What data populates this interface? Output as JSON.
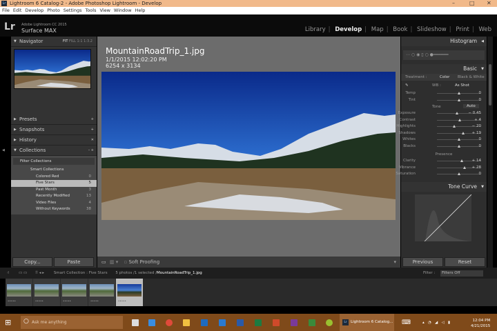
{
  "window": {
    "title": "Lightroom 6 Catalog-2 - Adobe Photoshop Lightroom - Develop"
  },
  "menu": [
    "File",
    "Edit",
    "Develop",
    "Photo",
    "Settings",
    "Tools",
    "View",
    "Window",
    "Help"
  ],
  "identity": {
    "logo": "Lr",
    "product": "Adobe Lightroom CC 2015",
    "name": "Surface MAX"
  },
  "modules": [
    {
      "label": "Library"
    },
    {
      "label": "Develop",
      "active": true
    },
    {
      "label": "Map"
    },
    {
      "label": "Book"
    },
    {
      "label": "Slideshow"
    },
    {
      "label": "Print"
    },
    {
      "label": "Web"
    }
  ],
  "left": {
    "navigator": {
      "title": "Navigator",
      "zoom": [
        "FIT",
        "FILL",
        "1:1",
        "1:3.2"
      ]
    },
    "panels": [
      "Presets",
      "Snapshots",
      "History",
      "Collections"
    ],
    "filter": "Filter Collections",
    "smart": "Smart Collections",
    "collections": [
      {
        "name": "Colored Red",
        "count": "0"
      },
      {
        "name": "Five Stars",
        "count": "5",
        "selected": true
      },
      {
        "name": "Past Month",
        "count": "3"
      },
      {
        "name": "Recently Modified",
        "count": "13"
      },
      {
        "name": "Video Files",
        "count": "4"
      },
      {
        "name": "Without Keywords",
        "count": "38"
      }
    ],
    "copy": "Copy...",
    "paste": "Paste"
  },
  "photo": {
    "filename": "MountainRoadTrip_1.jpg",
    "date": "1/1/2015 12:02:20 PM",
    "size": "6254 x 3134"
  },
  "toolbar": {
    "soft_proofing": "Soft Proofing"
  },
  "right": {
    "histogram": "Histogram",
    "basic": "Basic",
    "treatment_label": "Treatment :",
    "color": "Color",
    "bw": "Black & White",
    "wb_label": "WB :",
    "wb_value": "As Shot",
    "tone": "Tone",
    "auto": "Auto",
    "presence": "Presence",
    "sliders1": [
      {
        "label": "Temp",
        "value": "0",
        "pos": 0.5
      },
      {
        "label": "Tint",
        "value": "0",
        "pos": 0.5
      }
    ],
    "sliders2": [
      {
        "label": "Exposure",
        "value": "− 0.45",
        "pos": 0.46
      },
      {
        "label": "Contrast",
        "value": "+ 4",
        "pos": 0.52
      },
      {
        "label": "Highlights",
        "value": "− 20",
        "pos": 0.4
      },
      {
        "label": "Shadows",
        "value": "+ 19",
        "pos": 0.6
      },
      {
        "label": "Whites",
        "value": "0",
        "pos": 0.5
      },
      {
        "label": "Blacks",
        "value": "0",
        "pos": 0.5
      }
    ],
    "sliders3": [
      {
        "label": "Clarity",
        "value": "+ 14",
        "pos": 0.57
      },
      {
        "label": "Vibrance",
        "value": "+ 28",
        "pos": 0.64
      },
      {
        "label": "Saturation",
        "value": "0",
        "pos": 0.5
      }
    ],
    "tone_curve": "Tone Curve",
    "previous": "Previous",
    "reset": "Reset"
  },
  "filmstrip": {
    "source": "Smart Collection : Five Stars",
    "count": "5 photos /1 selected /",
    "selected_file": "MountainRoadTrip_1.jpg",
    "filter_label": "Filter :",
    "filter_value": "Filters Off",
    "stars": "•••••"
  },
  "taskbar": {
    "search": "Ask me anything",
    "app": "Lightroom 6 Catalog...",
    "time": "12:04 PM",
    "date": "4/21/2015"
  }
}
